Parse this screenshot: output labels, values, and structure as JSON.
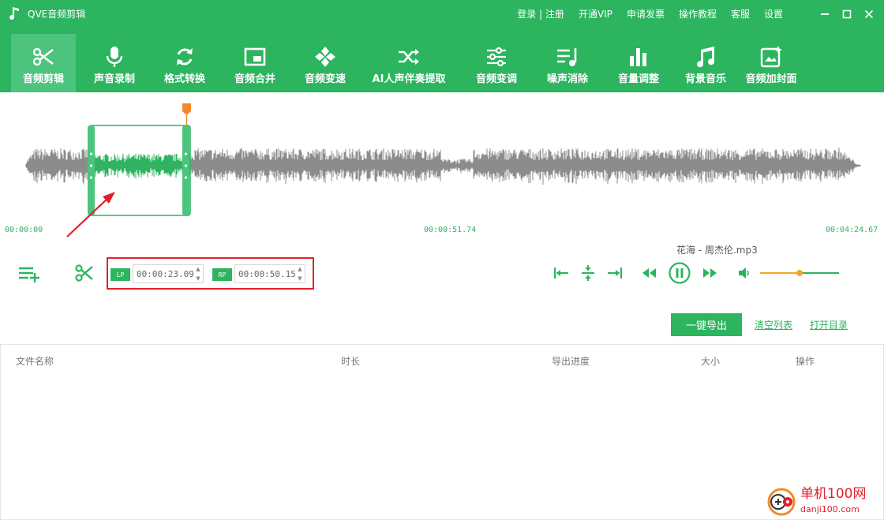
{
  "app": {
    "title": "QVE音频剪辑"
  },
  "top_links": [
    "登录 | 注册",
    "开通VIP",
    "申请发票",
    "操作教程",
    "客服",
    "设置"
  ],
  "toolbar": [
    {
      "label": "音频剪辑",
      "icon": "scissors-icon",
      "active": true
    },
    {
      "label": "声音录制",
      "icon": "microphone-icon",
      "active": false
    },
    {
      "label": "格式转换",
      "icon": "refresh-icon",
      "active": false
    },
    {
      "label": "音频合并",
      "icon": "merge-icon",
      "active": false
    },
    {
      "label": "音频变速",
      "icon": "speed-icon",
      "active": false
    },
    {
      "label": "AI人声伴奏提取",
      "icon": "shuffle-icon",
      "active": false
    },
    {
      "label": "音频变调",
      "icon": "sliders-icon",
      "active": false
    },
    {
      "label": "噪声消除",
      "icon": "noise-icon",
      "active": false
    },
    {
      "label": "音量调整",
      "icon": "volume-bars-icon",
      "active": false
    },
    {
      "label": "背景音乐",
      "icon": "music-note-icon",
      "active": false
    },
    {
      "label": "音频加封面",
      "icon": "cover-image-icon",
      "active": false
    }
  ],
  "timeline": {
    "start": "00:00:00",
    "middle": "00:00:51.74",
    "end": "00:04:24.67"
  },
  "range": {
    "lp_tag": "LP",
    "lp_value": "00:00:23.09",
    "rp_tag": "RP",
    "rp_value": "00:00:50.15"
  },
  "player": {
    "song": "花海 - 周杰伦.mp3",
    "volume": 0.5
  },
  "actions": {
    "export": "一键导出",
    "clear": "清空列表",
    "open_dir": "打开目录"
  },
  "table": {
    "columns": [
      "文件名称",
      "时长",
      "导出进度",
      "大小",
      "操作"
    ]
  },
  "watermark": {
    "line1": "单机100网",
    "line2": "danji100.com"
  },
  "colors": {
    "brand": "#2cb45f",
    "active_tab": "#4cc47d",
    "marker": "#f08a2c",
    "highlight": "#e0212b",
    "wave": "#808080"
  }
}
